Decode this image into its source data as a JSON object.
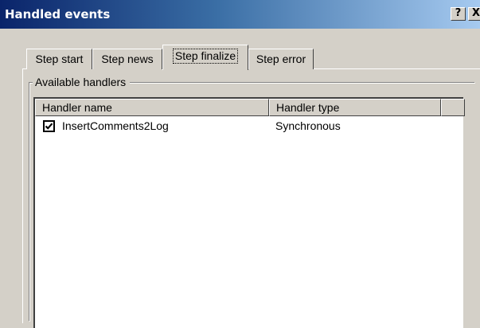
{
  "window": {
    "title": "Handled events",
    "help_label": "?",
    "close_label": "X"
  },
  "tabs": [
    {
      "label": "Step start"
    },
    {
      "label": "Step news"
    },
    {
      "label": "Step finalize",
      "active": true
    },
    {
      "label": "Step error"
    }
  ],
  "group": {
    "label": "Available handlers"
  },
  "listview": {
    "columns": [
      "Handler name",
      "Handler type"
    ],
    "rows": [
      {
        "checked": true,
        "name": "InsertComments2Log",
        "type": "Synchronous"
      }
    ]
  }
}
